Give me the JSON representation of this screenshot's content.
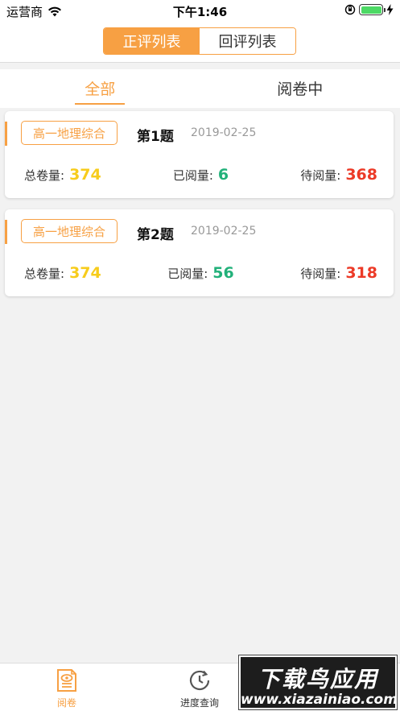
{
  "status_bar": {
    "carrier": "运营商",
    "time": "下午1:46"
  },
  "header": {
    "segments": [
      {
        "label": "正评列表",
        "active": true
      },
      {
        "label": "回评列表",
        "active": false
      }
    ]
  },
  "filter_tabs": [
    {
      "label": "全部",
      "active": true
    },
    {
      "label": "阅卷中",
      "active": false
    }
  ],
  "cards": [
    {
      "subject": "高一地理综合",
      "title": "第1题",
      "date": "2019-02-25",
      "total_label": "总卷量:",
      "total_value": "374",
      "read_label": "已阅量:",
      "read_value": "6",
      "pending_label": "待阅量:",
      "pending_value": "368"
    },
    {
      "subject": "高一地理综合",
      "title": "第2题",
      "date": "2019-02-25",
      "total_label": "总卷量:",
      "total_value": "374",
      "read_label": "已阅量:",
      "read_value": "56",
      "pending_label": "待阅量:",
      "pending_value": "318"
    }
  ],
  "bottom_nav": [
    {
      "label": "阅卷",
      "icon": "exam-paper-icon",
      "active": true
    },
    {
      "label": "进度查询",
      "icon": "clock-history-icon",
      "active": false
    }
  ],
  "watermark": {
    "title": "下载鸟应用",
    "site": "www.xiazainiao.com"
  },
  "colors": {
    "accent": "#f7a043",
    "total": "#f7cc1c",
    "read": "#22b17a",
    "pending": "#ec3a27"
  }
}
